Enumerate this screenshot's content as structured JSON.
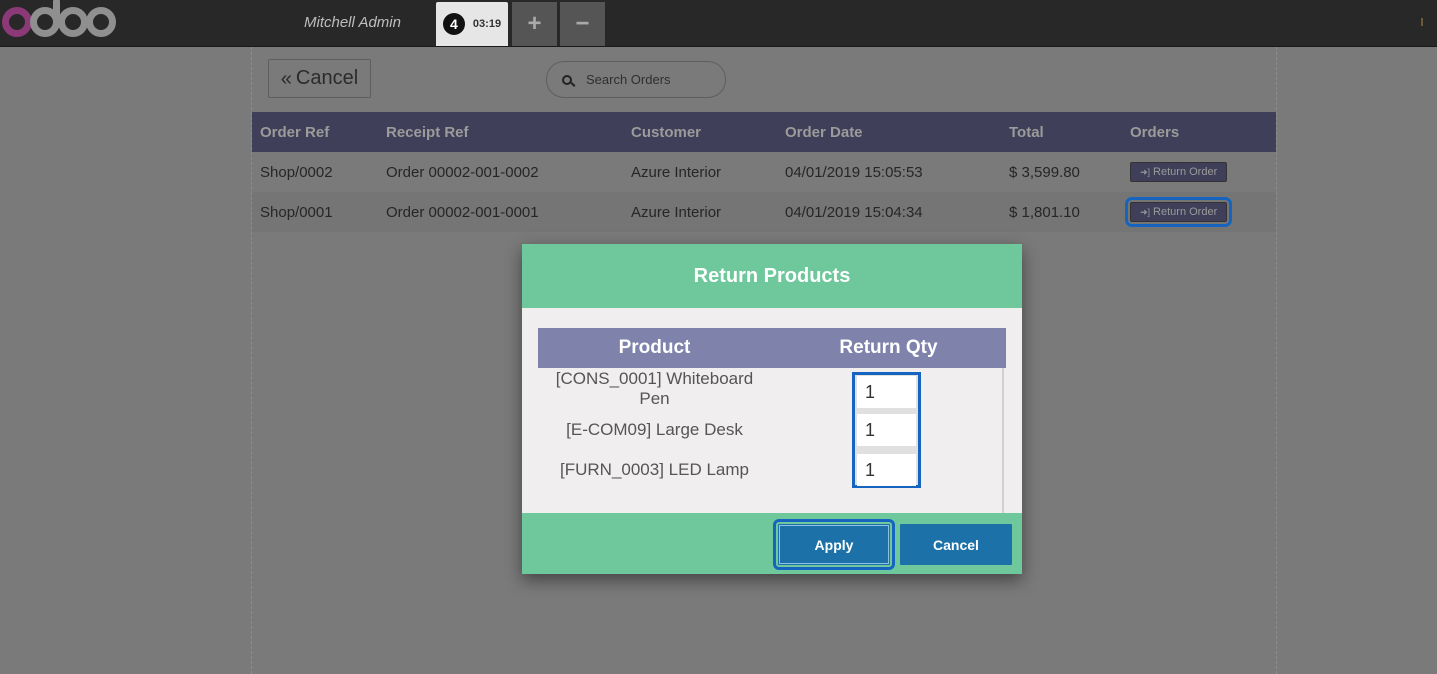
{
  "header": {
    "user_name": "Mitchell Admin",
    "order_tab": {
      "count": "4",
      "time": "03:19"
    },
    "add_icon": "plus-icon",
    "remove_icon": "minus-icon"
  },
  "toolbar": {
    "cancel_label": "Cancel",
    "search_placeholder": "Search Orders"
  },
  "orders_table": {
    "columns": [
      "Order Ref",
      "Receipt Ref",
      "Customer",
      "Order Date",
      "Total",
      "Orders"
    ],
    "rows": [
      {
        "order_ref": "Shop/0002",
        "receipt_ref": "Order 00002-001-0002",
        "customer": "Azure Interior",
        "order_date": "04/01/2019 15:05:53",
        "total": "$ 3,599.80",
        "action": "Return Order"
      },
      {
        "order_ref": "Shop/0001",
        "receipt_ref": "Order 00002-001-0001",
        "customer": "Azure Interior",
        "order_date": "04/01/2019 15:04:34",
        "total": "$ 1,801.10",
        "action": "Return Order"
      }
    ]
  },
  "modal": {
    "title": "Return Products",
    "columns": [
      "Product",
      "Return Qty"
    ],
    "products": [
      {
        "name_line1": "[CONS_0001] Whiteboard",
        "name_line2": "Pen",
        "qty": "1"
      },
      {
        "name_line1": "[E-COM09] Large Desk",
        "name_line2": "",
        "qty": "1"
      },
      {
        "name_line1": "[FURN_0003] LED Lamp",
        "name_line2": "",
        "qty": "1"
      }
    ],
    "apply_label": "Apply",
    "cancel_label": "Cancel"
  },
  "colors": {
    "modal_accent": "#6ec89b",
    "table_header": "#7f82ab",
    "primary_button": "#1c72a8",
    "focus_outline": "#1565c0"
  }
}
